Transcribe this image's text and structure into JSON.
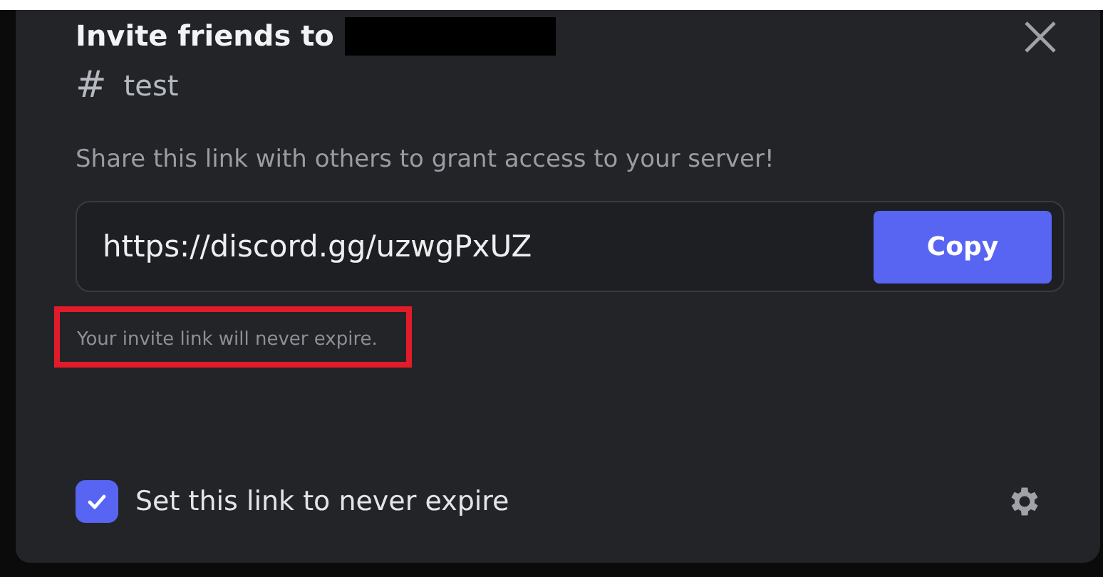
{
  "dialog": {
    "title": "Invite friends to",
    "server_name_redacted": true,
    "channel": {
      "icon": "#",
      "name": "test"
    },
    "description": "Share this link with others to grant access to your server!",
    "invite_link": {
      "value": "https://discord.gg/uzwgPxUZ",
      "button": "Copy"
    },
    "hint": {
      "text": "Your invite link will never expire.",
      "highlighted": true
    },
    "never_expire": {
      "label": "Set this link to never expire",
      "checked": true
    }
  }
}
